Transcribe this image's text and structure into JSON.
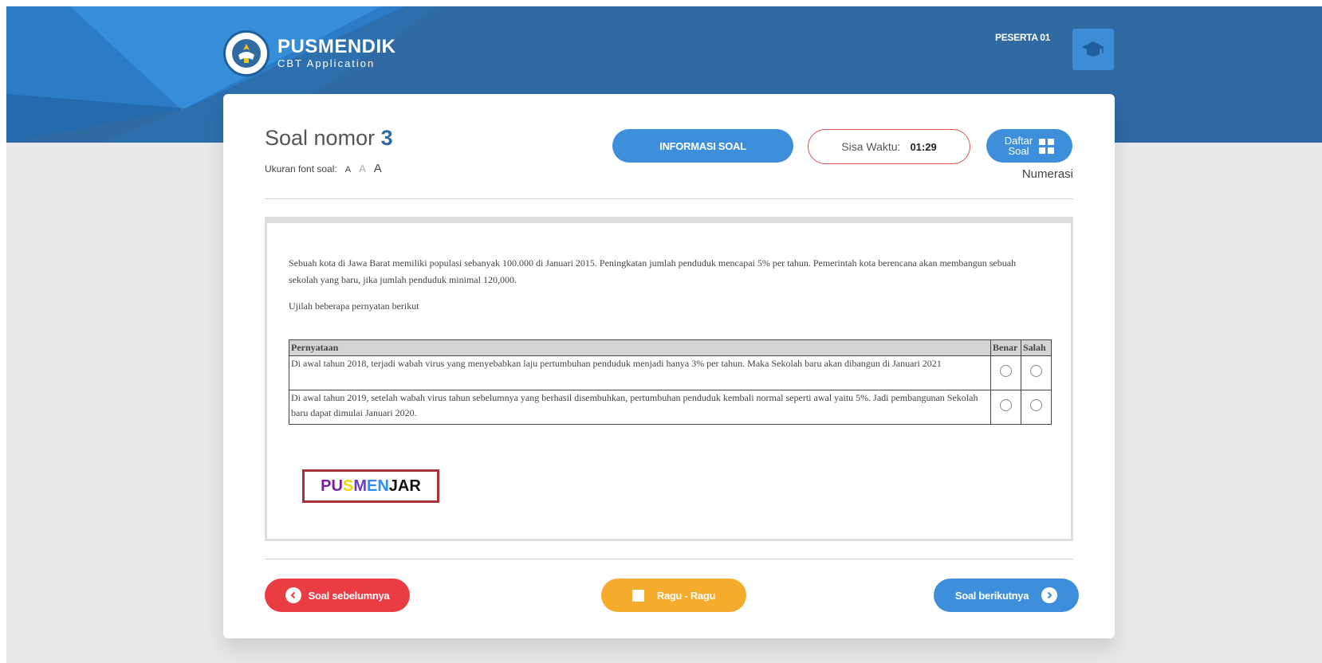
{
  "header": {
    "brand_title": "PUSMENDIK",
    "brand_subtitle": "CBT Application",
    "user_label": "PESERTA 01",
    "colors": {
      "header_bg": "#2f6aa3",
      "accent": "#3d8fdc"
    }
  },
  "question_header": {
    "title_prefix": "Soal nomor",
    "number": "3",
    "font_size_label": "Ukuran font soal:",
    "font_sizes": [
      "A",
      "A",
      "A"
    ],
    "info_button": "INFORMASI SOAL",
    "timer_label": "Sisa Waktu:",
    "timer_value": "01:29",
    "daftar_line1": "Daftar",
    "daftar_line2": "Soal",
    "category": "Numerasi"
  },
  "question": {
    "paragraph1": "Sebuah kota di Jawa Barat memiliki populasi sebanyak 100.000 di Januari 2015. Peningkatan jumlah penduduk mencapai 5% per tahun. Pemerintah kota berencana akan membangun sebuah sekolah yang baru, jika jumlah penduduk minimal 120,000.",
    "paragraph2": "Ujilah beberapa pernyatan berikut",
    "table_headers": [
      "Pernyataan",
      "Benar",
      "Salah"
    ],
    "rows": [
      {
        "statement": "Di awal tahun 2018, terjadi wabah virus yang menyebabkan laju pertumbuhan penduduk menjadi hanya 3% per tahun. Maka Sekolah baru akan dibangun di Januari 2021"
      },
      {
        "statement": "Di awal tahun 2019, setelah wabah virus tahun sebelumnya yang berhasil disembuhkan, pertumbuhan penduduk kembali normal seperti awal yaitu 5%. Jadi pembangunan Sekolah baru dapat dimulai Januari 2020."
      }
    ],
    "stamp_letters": [
      "P",
      "U",
      "S",
      "M",
      "E",
      "N",
      "J",
      "A",
      "R"
    ],
    "stamp_colors": [
      "#7a1fa2",
      "#7a1fa2",
      "#f2d600",
      "#6a3cc8",
      "#2e8bff",
      "#2e8bff",
      "#111111",
      "#111111",
      "#111111"
    ]
  },
  "navigation": {
    "prev": "Soal sebelumnya",
    "ragu": "Ragu - Ragu",
    "next": "Soal berikutnya"
  }
}
